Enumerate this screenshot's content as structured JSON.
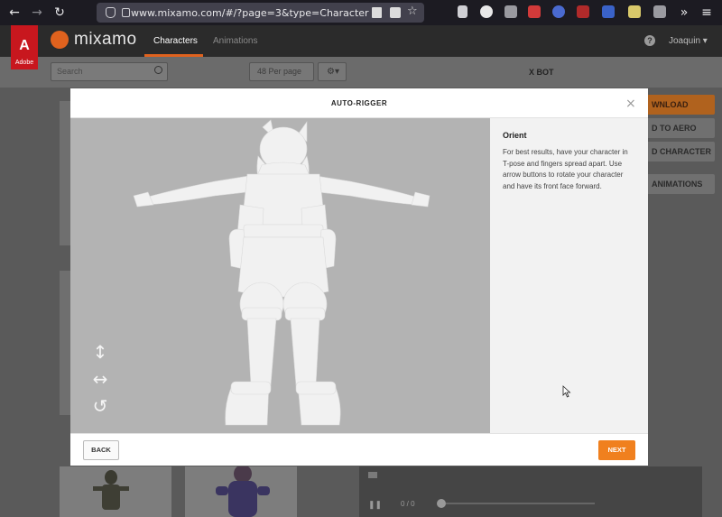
{
  "browser": {
    "back": "←",
    "forward": "→",
    "reload": "↻",
    "url": "www.mixamo.com/#/?page=3&type=Character",
    "menu": "≡",
    "overflow": "»"
  },
  "app": {
    "adobe_label": "Adobe",
    "adobe_letter": "A",
    "logo_text": "mixamo",
    "tabs": [
      {
        "label": "Characters",
        "active": true
      },
      {
        "label": "Animations",
        "active": false
      }
    ],
    "help": "?",
    "user": "Joaquin ▾"
  },
  "background": {
    "search_placeholder": "Search",
    "per_page": "48 Per page",
    "gear": "⚙▾",
    "character_name": "X BOT",
    "side_buttons": [
      "DOWNLOAD",
      "SEND TO AERO",
      "UPLOAD CHARACTER",
      "FIND ANIMATIONS"
    ],
    "side_buttons_visible": [
      "WNLOAD",
      "D TO AERO",
      "D CHARACTER",
      "ANIMATIONS"
    ],
    "player_time": "0 / 0"
  },
  "modal": {
    "title": "AUTO-RIGGER",
    "close": "×",
    "panel_heading": "Orient",
    "panel_text": "For best results, have your character in T-pose and fingers spread apart. Use arrow buttons to rotate your character and have its front face forward.",
    "back_label": "BACK",
    "next_label": "NEXT",
    "controls": [
      {
        "name": "vertical-arrows-icon",
        "glyph": "↕"
      },
      {
        "name": "horizontal-arrows-icon",
        "glyph": "↔"
      },
      {
        "name": "rotate-icon",
        "glyph": "↺"
      }
    ]
  },
  "colors": {
    "accent": "#f0801e",
    "adobe_red": "#c8171e",
    "viewport_bg": "#b3b3b3"
  }
}
